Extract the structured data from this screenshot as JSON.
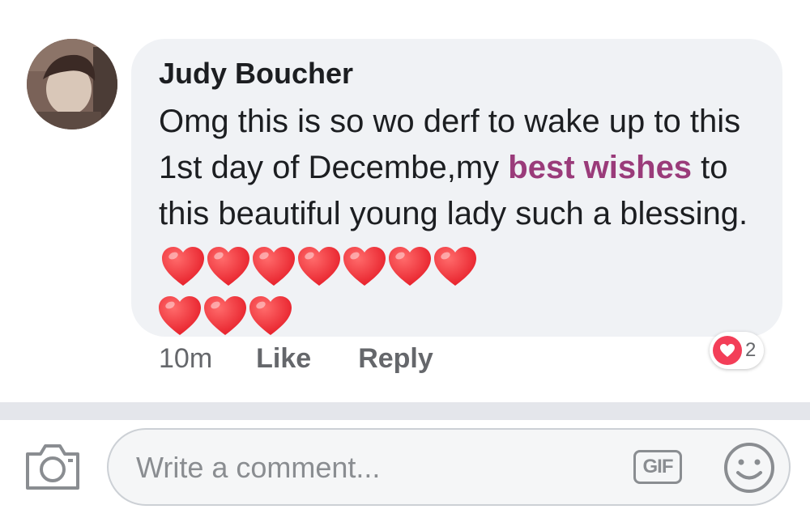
{
  "comment": {
    "author": "Judy Boucher",
    "text_before_tag": "Omg this is so wo derf to wake up to this 1st day of Decembe,my ",
    "tag_text": "best wishes",
    "text_after_tag": " to this beautiful young lady such a blessing.",
    "hearts_line1": 7,
    "hearts_line2": 3,
    "timestamp": "10m",
    "like_label": "Like",
    "reply_label": "Reply",
    "reaction_count": "2",
    "reaction_icon": "heart-reaction-icon",
    "colors": {
      "tag": "#9a3b7a",
      "heart": "#e8232d",
      "reaction": "#f33e58"
    }
  },
  "composer": {
    "placeholder": "Write a comment...",
    "gif_label": "GIF",
    "camera_icon": "camera-icon",
    "emoji_icon": "smiley-icon"
  }
}
